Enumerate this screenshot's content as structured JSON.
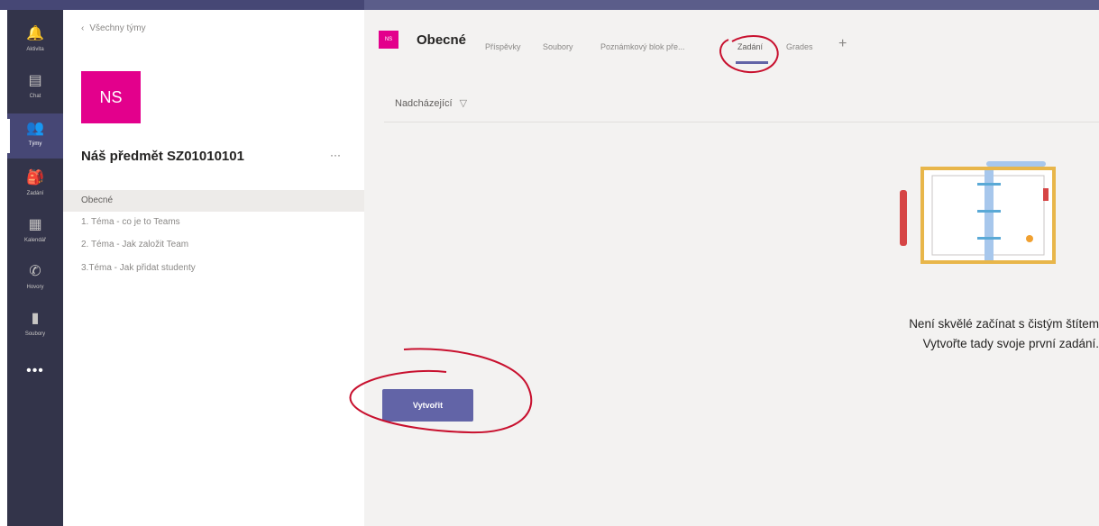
{
  "rail": {
    "items": [
      {
        "icon": "bell-icon",
        "glyph": "🔔",
        "label": "Aktivita"
      },
      {
        "icon": "chat-icon",
        "glyph": "▤",
        "label": "Chat"
      },
      {
        "icon": "teams-icon",
        "glyph": "👥",
        "label": "Týmy"
      },
      {
        "icon": "assignments-icon",
        "glyph": "🎒",
        "label": "Zadání"
      },
      {
        "icon": "calendar-icon",
        "glyph": "▦",
        "label": "Kalendář"
      },
      {
        "icon": "phone-icon",
        "glyph": "✆",
        "label": "Hovory"
      },
      {
        "icon": "files-icon",
        "glyph": "▮",
        "label": "Soubory"
      }
    ],
    "more": "•••",
    "accent": "#464775"
  },
  "sidebar": {
    "back_label": "Všechny týmy",
    "team_initials": "NS",
    "team_name": "Náš předmět SZ01010101",
    "more": "···",
    "channels": [
      "Obecné",
      "1. Téma - co je to Teams",
      "2. Téma - Jak založit Team",
      "3.Téma - Jak přidat studenty"
    ]
  },
  "channel_header": {
    "avatar": "NS",
    "title": "Obecné",
    "tabs": [
      "Příspěvky",
      "Soubory",
      "Poznámkový blok pře...",
      "Zadání",
      "Grades"
    ],
    "active_tab": "Zadání",
    "add": "+"
  },
  "filter": {
    "label": "Nadcházející",
    "icon": "filter-icon"
  },
  "empty_state": {
    "line1": "Není skvělé začínat s čistým štítem",
    "line2": "Vytvořte tady svoje první zadání."
  },
  "create_button": "Vytvořit",
  "colors": {
    "brand": "#6264a7",
    "team_avatar": "#e3008c",
    "rail_bg": "#33344a",
    "annotation": "#c8102e"
  }
}
